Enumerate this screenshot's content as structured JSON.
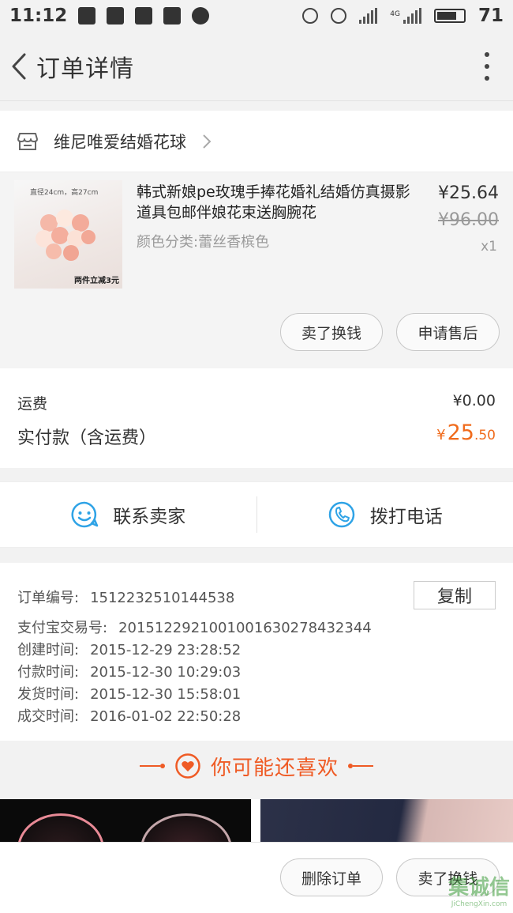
{
  "status_bar": {
    "time": "11:12",
    "network": "4G",
    "battery": "71"
  },
  "header": {
    "title": "订单详情"
  },
  "store": {
    "name": "维尼唯爱结婚花球"
  },
  "product": {
    "title": "韩式新娘pe玫瑰手捧花婚礼结婚仿真摄影道具包邮伴娘花束送胸腕花",
    "sku": "颜色分类:蕾丝香槟色",
    "price_now": "¥25.64",
    "price_old": "¥96.00",
    "quantity": "x1",
    "image_caption_top": "直径24cm，高27cm",
    "image_caption_bottom": "两件立减3元",
    "sell_button": "卖了换钱",
    "after_sale_button": "申请售后"
  },
  "cost": {
    "freight_label": "运费",
    "freight_value": "¥0.00",
    "total_label": "实付款（含运费）",
    "total_currency": "¥",
    "total_integer": "25",
    "total_decimal": ".50"
  },
  "contact": {
    "seller_label": "联系卖家",
    "call_label": "拨打电话"
  },
  "order_info": {
    "order_no_label": "订单编号:",
    "order_no": "1512232510144538",
    "copy_button": "复制",
    "alipay_label": "支付宝交易号:",
    "alipay_no": "2015122921001001630278432344",
    "created_label": "创建时间:",
    "created": "2015-12-29 23:28:52",
    "paid_label": "付款时间:",
    "paid": "2015-12-30 10:29:03",
    "shipped_label": "发货时间:",
    "shipped": "2015-12-30 15:58:01",
    "completed_label": "成交时间:",
    "completed": "2016-01-02 22:50:28"
  },
  "recommend": {
    "title": "你可能还喜欢"
  },
  "bottom_bar": {
    "delete_button": "删除订单",
    "sell_button": "卖了换钱"
  },
  "watermark": {
    "main": "集诚信",
    "sub": "JiChengXin.com"
  },
  "colors": {
    "accent": "#f06b1c",
    "recommend": "#ef5b25",
    "icon_blue": "#2fa3e6"
  }
}
